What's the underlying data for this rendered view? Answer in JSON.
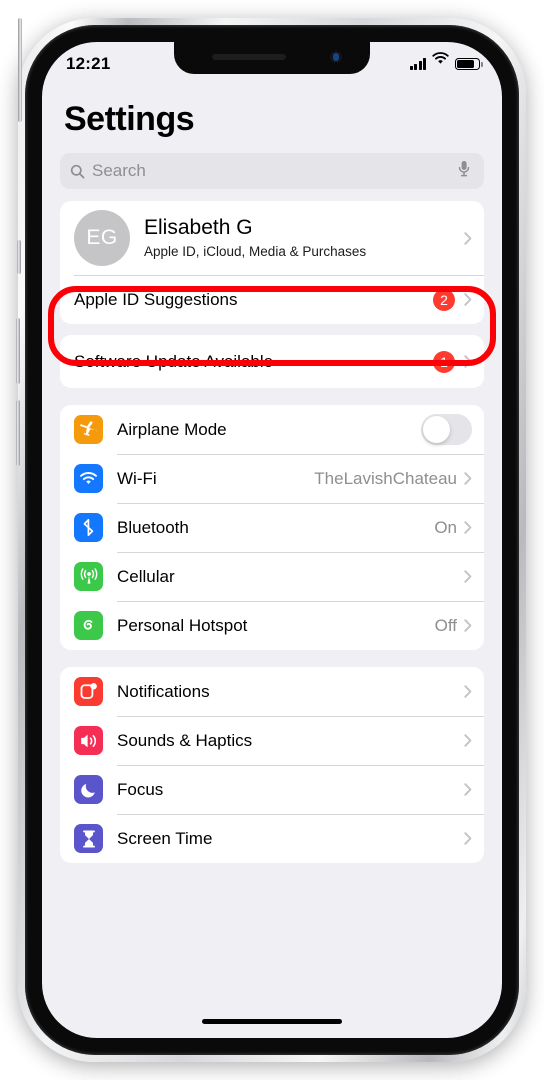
{
  "status_bar": {
    "time": "12:21",
    "signal_icon": "cellular-bars-icon",
    "wifi_icon": "wifi-icon",
    "battery_icon": "battery-icon"
  },
  "header": {
    "title": "Settings"
  },
  "search": {
    "placeholder": "Search",
    "icon": "search-icon",
    "mic_icon": "microphone-icon"
  },
  "account": {
    "initials": "EG",
    "name": "Elisabeth G",
    "subtitle": "Apple ID, iCloud, Media & Purchases",
    "highlighted": "true"
  },
  "suggestions": {
    "label": "Apple ID Suggestions",
    "badge": "2"
  },
  "software_update": {
    "label": "Software Update Available",
    "badge": "1"
  },
  "connectivity": [
    {
      "label": "Airplane Mode",
      "icon": "airplane-icon",
      "color": "#f59a0b",
      "control": "toggle",
      "toggle_on": "false"
    },
    {
      "label": "Wi-Fi",
      "icon": "wifi-icon",
      "color": "#1478ff",
      "value": "TheLavishChateau"
    },
    {
      "label": "Bluetooth",
      "icon": "bluetooth-icon",
      "color": "#1478ff",
      "value": "On"
    },
    {
      "label": "Cellular",
      "icon": "cellular-icon",
      "color": "#3cc94a",
      "value": ""
    },
    {
      "label": "Personal Hotspot",
      "icon": "hotspot-icon",
      "color": "#3cc94a",
      "value": "Off"
    }
  ],
  "system": [
    {
      "label": "Notifications",
      "icon": "notifications-icon",
      "color": "#fc3b30"
    },
    {
      "label": "Sounds & Haptics",
      "icon": "sounds-icon",
      "color": "#f52e55"
    },
    {
      "label": "Focus",
      "icon": "focus-moon-icon",
      "color": "#5a55ca"
    },
    {
      "label": "Screen Time",
      "icon": "screen-time-icon",
      "color": "#5a55ca"
    }
  ],
  "colors": {
    "background": "#efeff4",
    "card": "#ffffff",
    "badge": "#ff3b30",
    "highlight": "#fb0007",
    "secondary_text": "#8e8e93"
  }
}
